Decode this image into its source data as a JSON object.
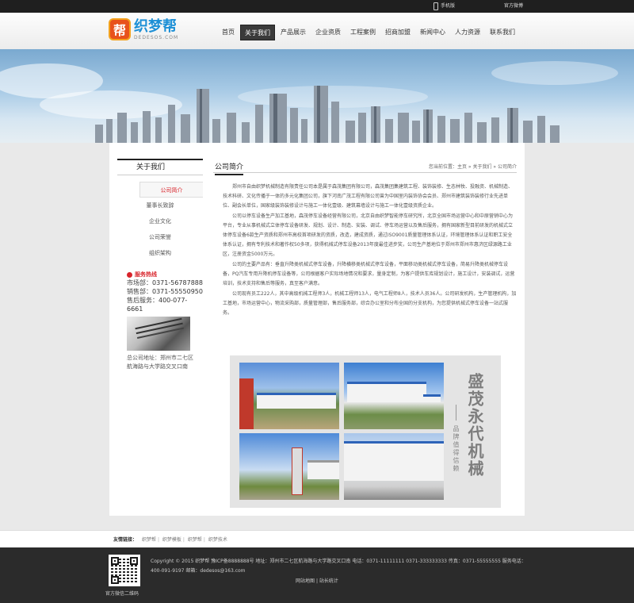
{
  "topbar": {
    "mobile": "手机版",
    "weibo": "官方微博"
  },
  "logo": {
    "cn": "织梦帮",
    "en": "DEDESOS.COM",
    "mark": "帮"
  },
  "nav": [
    {
      "label": "首页"
    },
    {
      "label": "关于我们",
      "active": true
    },
    {
      "label": "产品展示"
    },
    {
      "label": "企业资质"
    },
    {
      "label": "工程案例"
    },
    {
      "label": "招商加盟"
    },
    {
      "label": "新闻中心"
    },
    {
      "label": "人力资源"
    },
    {
      "label": "联系我们"
    }
  ],
  "sidebar": {
    "title": "关于我们",
    "items": [
      "公司简介",
      "董事长致辞",
      "企业文化",
      "公司荣誉",
      "组织架构"
    ],
    "hotline_title": "服务热线",
    "rows": [
      {
        "label": "市场部：",
        "value": "0371-56787888"
      },
      {
        "label": "销售部：",
        "value": "0371-55550950"
      },
      {
        "label": "售后服务：",
        "value": "400-077-6661"
      }
    ],
    "address": "总公司地址：郑州市二七区航海路与大学路交叉口南"
  },
  "content": {
    "title": "公司简介",
    "breadcrumb": "您当前位置：主页 » 关于我们 » 公司简介",
    "paragraphs": [
      "郑州市自由织梦机械制造有限责任公司本是属于森茂集团有限公司，森茂集团集建筑工程、装饰装修、生态林牧、投融资、机械制造、技术科研、文化传播于一体的多元化集团公司，旗下河南广茂工程有限公司曾为中国室内装饰协会会员、郑州市建筑装饰装修行业先进单位、副会长单位，国家级装饰装修设计与施工一体化壹级、建筑幕墙设计与施工一体化壹级资质企业。",
      "公司以停车设备生产加工基地，森茂停车设备经营有限公司，北京自由织梦智能停车研究所，北京全国市场运营中心和中原营销中心为平台，专业从事机械式立体停车设备研发、规划、设计、制造、安装、调试、停车场运营以及售后服务，拥有国家新型目前研发的机械式立体停车设备6款生产资质和郑州市高校首项研发的资质，改造，建成资质，通过ISO9001质量管理体系认证，环境管理体系认证和职工安全体系认证，拥有专利技术和著作权50多项，获得机械式停车设备2013年度最佳进步奖，公司生产基地位于郑州市郑州市惠济区绿源路工业区，注册资金5000万元。",
      "公司的主要产品有：垂直升降类机械式停车设备，升降横移类机械式停车设备，平面移动类机械式停车设备，简易升降类机械停车设备，PQ汽车专用升降机停车设备等，公司根据客户实际场地情况和要求，量身定制，为客户提供车库规划设计，施工设计，安装调试，运营培训，技术支持和售后等服务，真至客户满意。",
      "公司现有员工222人，其中高级机械工程师3人，机械工程师13人，电气工程师8人，技术人员36人。公司研发机构，生产管理机构，加工基地，市场运营中心，物流采购部，质量管理部，售后服务部，综合办公室和分布全国的分支机构，为您提供机械式停车设备一站式服务。"
    ]
  },
  "brand": {
    "big": "盛茂永代机械",
    "small": "品牌值得信赖"
  },
  "links": {
    "label": "友情链接：",
    "items": [
      "织梦帮",
      "织梦模板",
      "织梦帮",
      "织梦技术"
    ]
  },
  "footer": {
    "qr_caption": "官方微信二维码",
    "line1": "Copyright © 2015   织梦帮 豫ICP备8888888号 地址：郑州市二七区航海路与大学路交叉口南    电话：0371-11111111 0371-333333333 传真：0371-55555555 服务电话：400-091-9197 邮箱：dedesos@163.com",
    "links": [
      "网站地图",
      "站长统计"
    ]
  }
}
